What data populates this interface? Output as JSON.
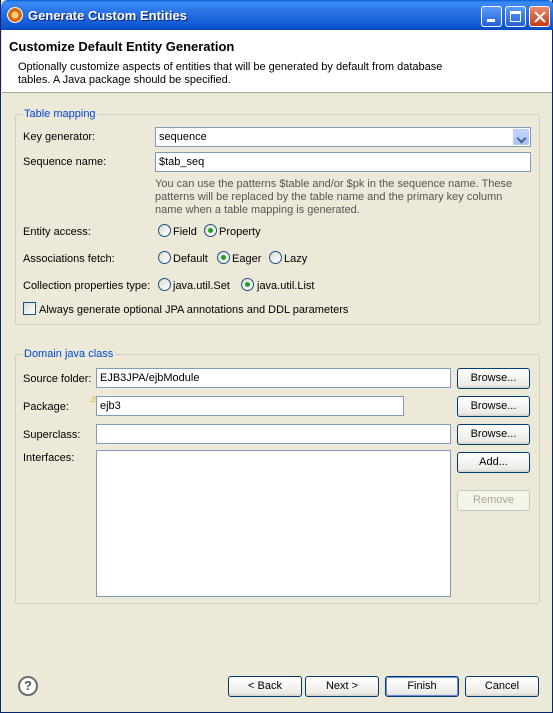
{
  "window": {
    "title": "Generate Custom Entities"
  },
  "header": {
    "title": "Customize Default Entity Generation",
    "description": "Optionally customize aspects of entities that will be generated by default from database tables. A Java package should be specified."
  },
  "table_mapping": {
    "legend": "Table mapping",
    "key_generator": {
      "label": "Key generator:",
      "value": "sequence"
    },
    "sequence_name": {
      "label": "Sequence name:",
      "value": "$tab_seq"
    },
    "hint": "You can use the patterns $table and/or $pk in the sequence name. These patterns will be replaced by the table name and the primary key column name when a table mapping is generated.",
    "entity_access": {
      "label": "Entity access:",
      "options": [
        {
          "label": "Field",
          "selected": false
        },
        {
          "label": "Property",
          "selected": true
        }
      ]
    },
    "associations_fetch": {
      "label": "Associations fetch:",
      "options": [
        {
          "label": "Default",
          "selected": false
        },
        {
          "label": "Eager",
          "selected": true
        },
        {
          "label": "Lazy",
          "selected": false
        }
      ]
    },
    "collection_type": {
      "label": "Collection properties type:",
      "options": [
        {
          "label": "java.util.Set",
          "selected": false
        },
        {
          "label": "java.util.List",
          "selected": true
        }
      ]
    },
    "always_generate": {
      "label": "Always generate optional JPA annotations and DDL parameters",
      "checked": false
    }
  },
  "domain_class": {
    "legend": "Domain java class",
    "source_folder": {
      "label": "Source folder:",
      "value": "EJB3JPA/ejbModule"
    },
    "package": {
      "label": "Package:",
      "value": "ejb3"
    },
    "superclass": {
      "label": "Superclass:",
      "value": ""
    },
    "interfaces": {
      "label": "Interfaces:"
    },
    "browse_label": "Browse...",
    "add_label": "Add...",
    "remove_label": "Remove"
  },
  "footer": {
    "back_label": "< Back",
    "next_label": "Next >",
    "finish_label": "Finish",
    "cancel_label": "Cancel"
  }
}
